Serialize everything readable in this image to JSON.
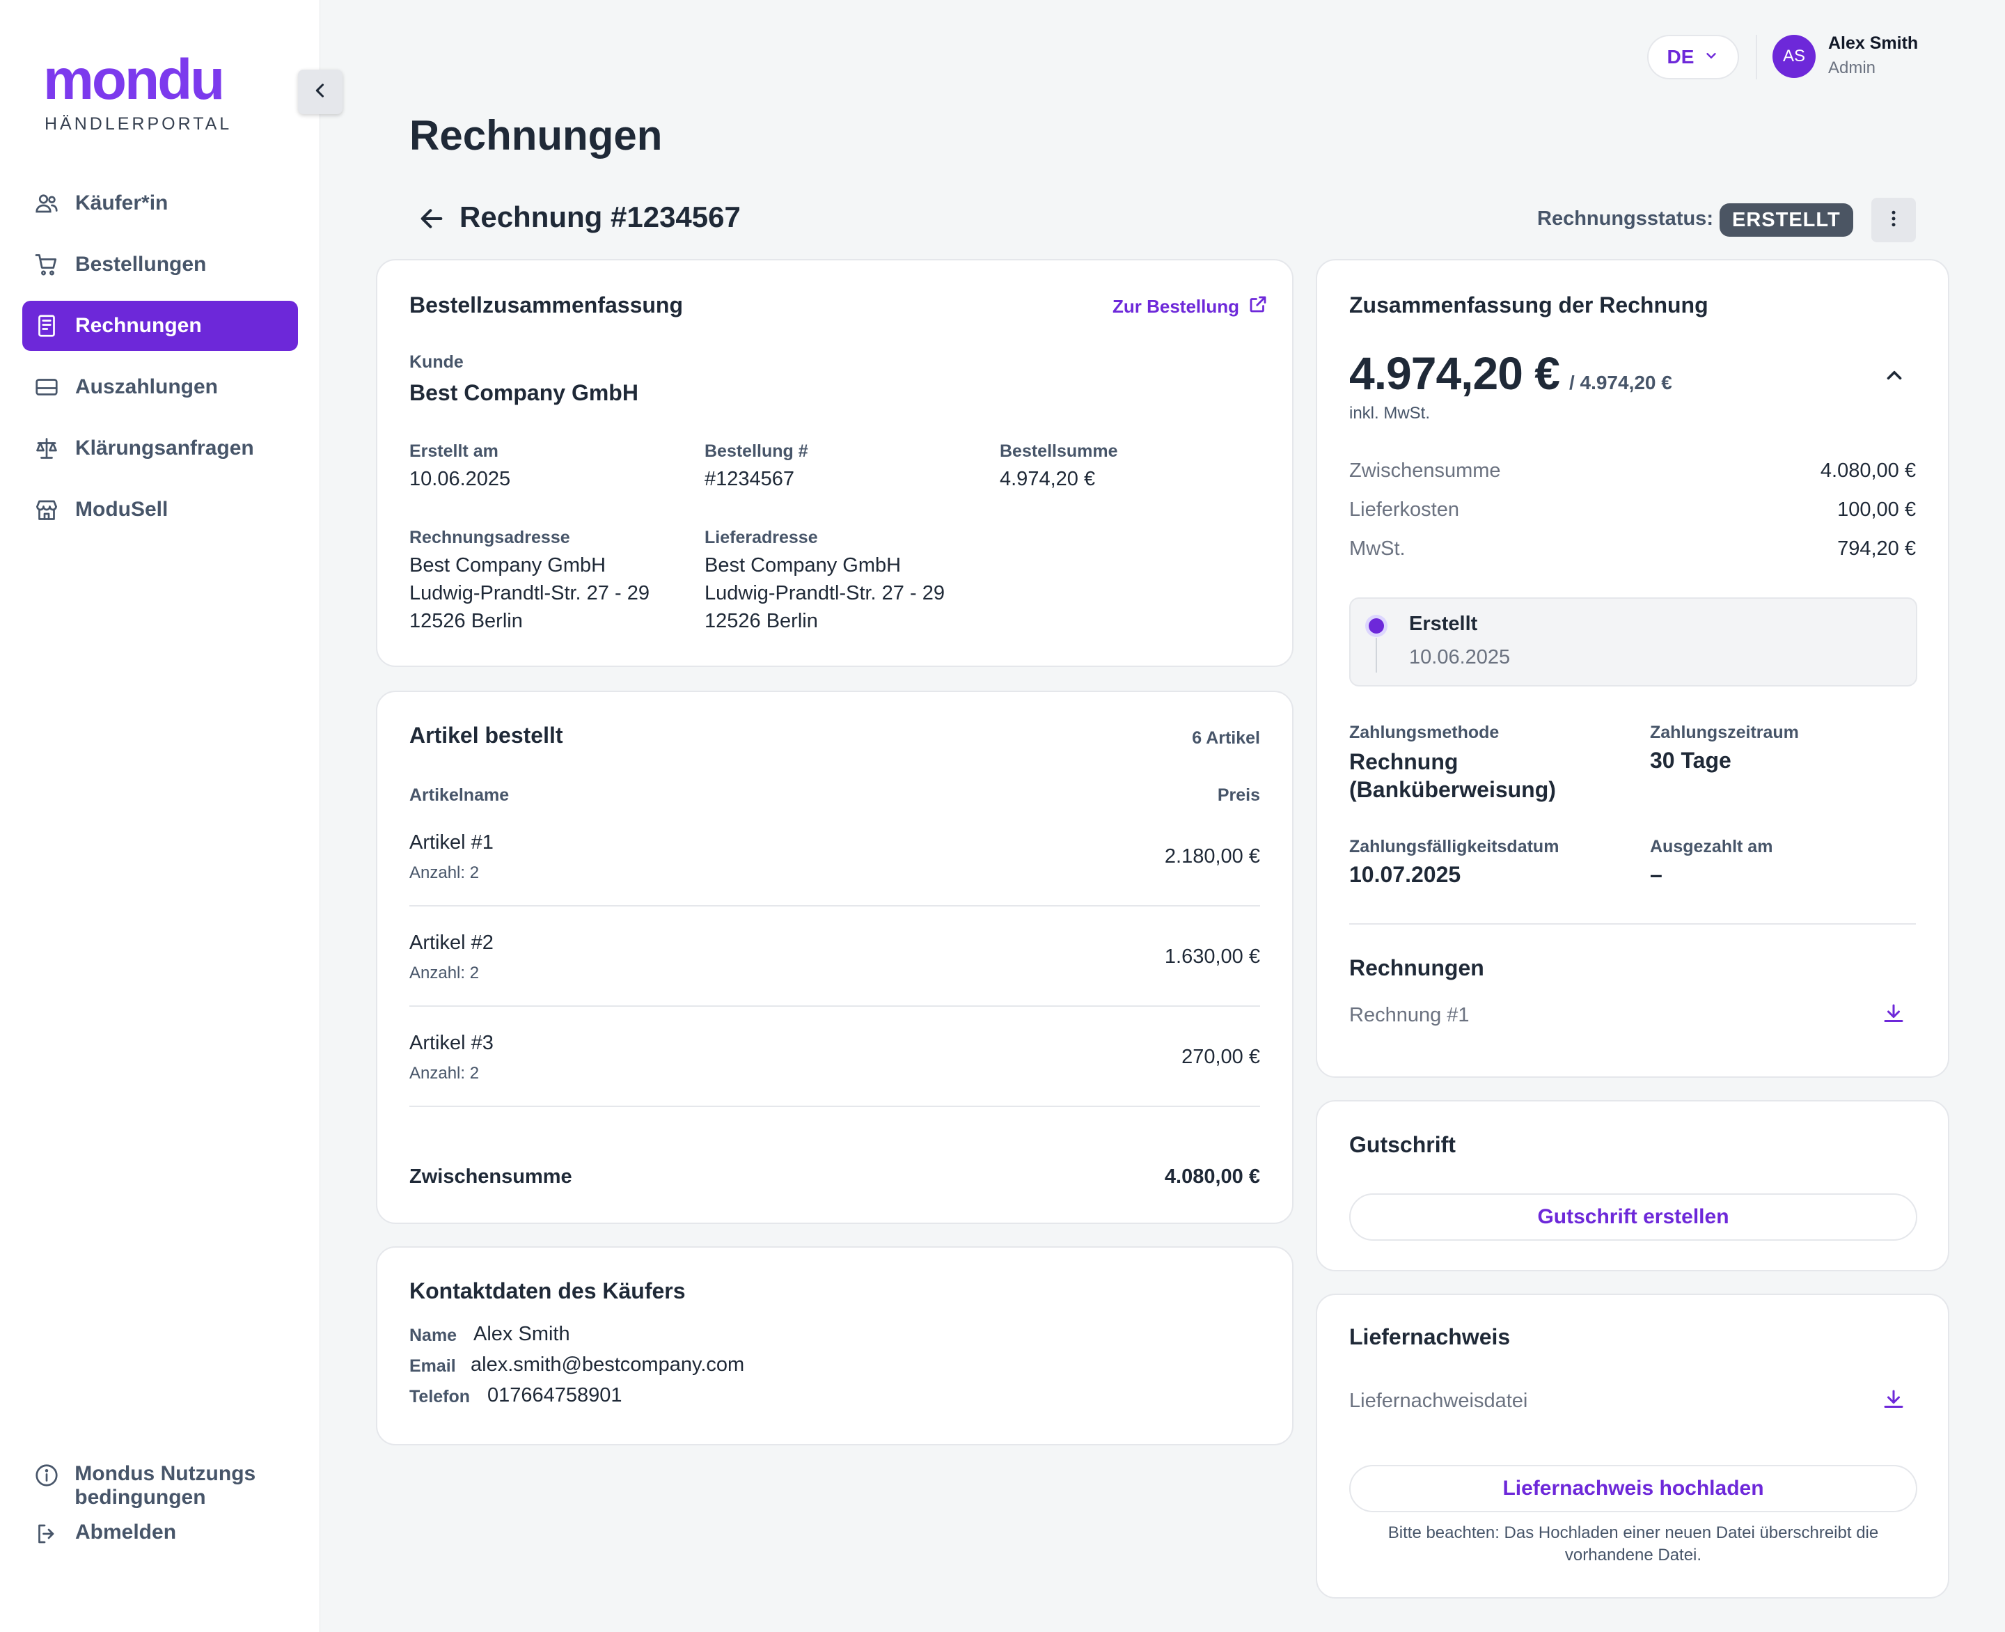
{
  "brand": {
    "name": "mondu",
    "subtitle": "HÄNDLERPORTAL",
    "accent": "#6d28d9"
  },
  "sidebar": {
    "items": [
      {
        "label": "Käufer*in",
        "icon": "users-icon"
      },
      {
        "label": "Bestellungen",
        "icon": "cart-icon"
      },
      {
        "label": "Rechnungen",
        "icon": "invoice-icon",
        "active": true
      },
      {
        "label": "Auszahlungen",
        "icon": "wallet-icon"
      },
      {
        "label": "Klärungsanfragen",
        "icon": "scale-icon"
      },
      {
        "label": "ModuSell",
        "icon": "store-icon"
      }
    ],
    "bottom": {
      "terms": "Mondus Nutzungsbedingungen",
      "logout": "Abmelden"
    }
  },
  "topbar": {
    "language": "DE",
    "user": {
      "initials": "AS",
      "name": "Alex Smith",
      "role": "Admin"
    }
  },
  "page": {
    "title": "Rechnungen",
    "invoice_title": "Rechnung #1234567",
    "status_label": "Rechnungsstatus:",
    "status_value": "ERSTELLT",
    "status_color": "#4b5563"
  },
  "order_summary": {
    "title": "Bestellzusammenfassung",
    "link": "Zur Bestellung",
    "customer_label": "Kunde",
    "customer": "Best Company GmbH",
    "created_label": "Erstellt am",
    "created": "10.06.2025",
    "order_no_label": "Bestellung #",
    "order_no": "#1234567",
    "total_label": "Bestellsumme",
    "total": "4.974,20 €",
    "billing_label": "Rechnungsadresse",
    "billing": {
      "line1": "Best Company GmbH",
      "line2": "Ludwig-Prandtl-Str. 27 - 29",
      "line3": "12526 Berlin"
    },
    "shipping_label": "Lieferadresse",
    "shipping": {
      "line1": "Best Company GmbH",
      "line2": "Ludwig-Prandtl-Str. 27 - 29",
      "line3": "12526 Berlin"
    }
  },
  "items": {
    "title": "Artikel bestellt",
    "count": "6 Artikel",
    "col_name": "Artikelname",
    "col_price": "Preis",
    "rows": [
      {
        "name": "Artikel #1",
        "qty": "Anzahl: 2",
        "price": "2.180,00 €"
      },
      {
        "name": "Artikel #2",
        "qty": "Anzahl: 2",
        "price": "1.630,00 €"
      },
      {
        "name": "Artikel #3",
        "qty": "Anzahl: 2",
        "price": "270,00 €"
      }
    ],
    "subtotal_label": "Zwischensumme",
    "subtotal": "4.080,00 €"
  },
  "contact": {
    "title": "Kontaktdaten des Käufers",
    "name_label": "Name",
    "name": "Alex Smith",
    "email_label": "Email",
    "email": "alex.smith@bestcompany.com",
    "phone_label": "Telefon",
    "phone": "017664758901"
  },
  "invoice_summary": {
    "title": "Zusammenfassung der Rechnung",
    "amount": "4.974,20 €",
    "amount_total": "/ 4.974,20 €",
    "vat_note": "inkl. MwSt.",
    "lines": [
      {
        "label": "Zwischensumme",
        "value": "4.080,00 €"
      },
      {
        "label": "Lieferkosten",
        "value": "100,00 €"
      },
      {
        "label": "MwSt.",
        "value": "794,20 €"
      }
    ],
    "timeline": {
      "status": "Erstellt",
      "date": "10.06.2025"
    },
    "payment_method_label": "Zahlungsmethode",
    "payment_method_line1": "Rechnung",
    "payment_method_line2": "(Banküberweisung)",
    "payment_term_label": "Zahlungszeitraum",
    "payment_term": "30 Tage",
    "due_label": "Zahlungsfälligkeitsdatum",
    "due": "10.07.2025",
    "paid_label": "Ausgezahlt am",
    "paid": "–",
    "invoices_title": "Rechnungen",
    "invoice_file": "Rechnung #1"
  },
  "credit": {
    "title": "Gutschrift",
    "button": "Gutschrift erstellen"
  },
  "delivery": {
    "title": "Liefernachweis",
    "file_label": "Liefernachweisdatei",
    "button": "Liefernachweis hochladen",
    "note_line1": "Bitte beachten: Das Hochladen einer neuen Datei überschreibt die",
    "note_line2": "vorhandene Datei."
  }
}
